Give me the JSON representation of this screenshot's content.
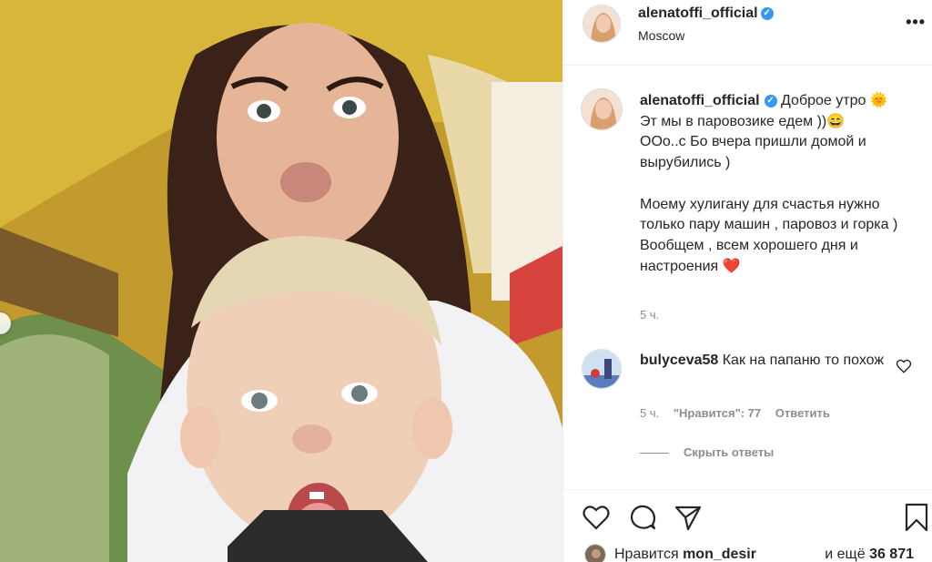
{
  "post": {
    "username": "alenatoffi_official",
    "verified_icon": "verified-badge-icon",
    "location": "Moscow",
    "more_icon": "more-options-icon",
    "caption_lines": [
      "Доброе утро 🌞",
      "Эт мы в паровозике едем ))😄",
      "Ооо..с Бо вчера пришли домой и вырубились )",
      "",
      "Моему хулигану для счастья нужно только пару машин , паровоз и горка )",
      "Вообщем , всем хорошего дня и настроения ❤️"
    ],
    "caption_text": "Доброе утро 🌞\nЭт мы в паровозике едем ))😄\nООо..с Бо вчера пришли домой и вырубились )\n\nМоему хулигану для счастья нужно только пару машин , паровоз и горка )\nВообщем , всем хорошего дня и настроения ❤️",
    "caption_time": "5 ч."
  },
  "comment": {
    "username": "bulyceva58",
    "text": "Как на папаню то похож",
    "time": "5 ч.",
    "likes": "\"Нравится\": 77",
    "reply": "Ответить",
    "hide_replies": "Скрыть ответы"
  },
  "actions": {
    "like_icon": "heart-icon",
    "comment_icon": "comment-icon",
    "share_icon": "share-icon",
    "save_icon": "bookmark-icon"
  },
  "likes": {
    "prefix": "Нравится",
    "user": "mon_desir",
    "suffix_prefix": "и ещё",
    "count": "36 871"
  },
  "colors": {
    "text": "#262626",
    "secondary": "#8e8e8e",
    "verified": "#3897f0",
    "border": "#efefef"
  }
}
